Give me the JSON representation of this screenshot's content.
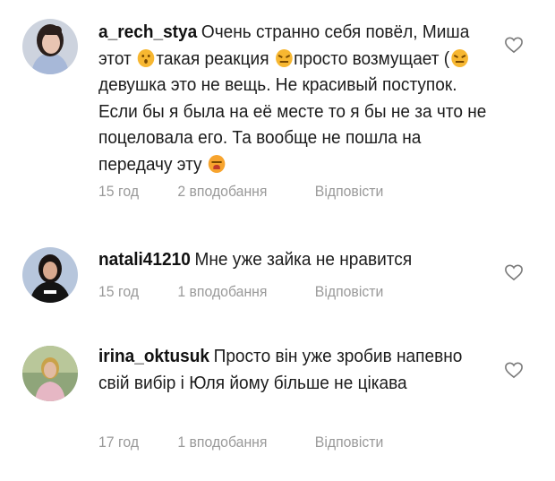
{
  "comments": [
    {
      "username": "a_rech_stya",
      "segments": [
        "Очень странно себя повёл, Миша этот ",
        "такая реакция ",
        "просто возмущает (",
        " девушка это не вещь. Не красивый поступок. Если бы я была на её месте то я бы не за что не поцеловала его. Та вообще не пошла на передачу эту "
      ],
      "time": "15 год",
      "likes": "2 вподобання",
      "reply": "Відповісти",
      "emoji_icons": [
        "hushed-face-icon",
        "confounded-face-icon",
        "confounded-face-icon",
        "tired-face-icon"
      ]
    },
    {
      "username": "natali41210",
      "text": "Мне уже зайка не нравится",
      "time": "15 год",
      "likes": "1 вподобання",
      "reply": "Відповісти"
    },
    {
      "username": "irina_oktusuk",
      "text": "Просто він уже зробив напевно свій вибір і Юля йому більше не цікава",
      "time": "17 год",
      "likes": "1 вподобання",
      "reply": "Відповісти"
    }
  ],
  "colors": {
    "meta": "#9a9a9a",
    "text": "#1c1c1c"
  }
}
